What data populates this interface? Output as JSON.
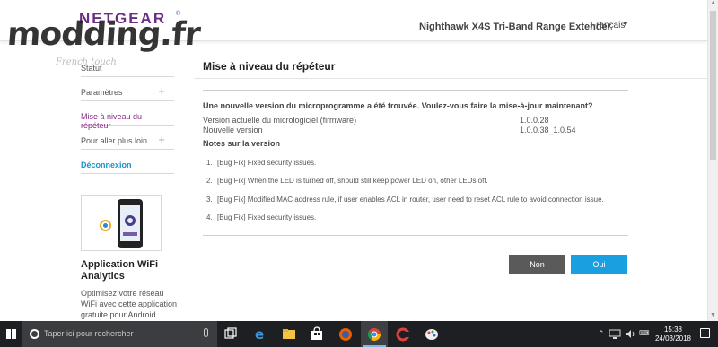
{
  "header": {
    "brand": "NETGEAR",
    "brand_mark": "®",
    "product": "Nighthawk X4S Tri-Band Range Extender",
    "language": "Français"
  },
  "watermark": {
    "text": "modding.fr",
    "sub": "French touch"
  },
  "sidebar": {
    "items": [
      {
        "label": "Statut",
        "expandable": false
      },
      {
        "label": "Paramètres",
        "expandable": true
      },
      {
        "label": "Mise à niveau du répéteur",
        "expandable": false,
        "active": true
      },
      {
        "label": "Pour aller plus loin",
        "expandable": true
      },
      {
        "label": "Déconnexion",
        "expandable": false
      }
    ],
    "app_title": "Application WiFi Analytics",
    "app_description": "Optimisez votre réseau WiFi avec cette application gratuite pour Android."
  },
  "main": {
    "title": "Mise à niveau du répéteur",
    "question": "Une nouvelle version du microprogramme a été trouvée. Voulez-vous faire la mise-à-jour maintenant?",
    "current_version_label": "Version actuelle du micrologiciel (firmware)",
    "current_version": "1.0.0.28",
    "new_version_label": "Nouvelle version",
    "new_version": "1.0.0.38_1.0.54",
    "notes_title": "Notes sur la version",
    "notes": [
      {
        "num": "1.",
        "text": "[Bug Fix] Fixed security issues."
      },
      {
        "num": "2.",
        "text": "[Bug Fix] When the LED is turned off, should still keep power LED on, other LEDs off."
      },
      {
        "num": "3.",
        "text": "[Bug Fix] Modified MAC address rule, if user enables ACL in router, user need to reset ACL rule to avoid connection issue."
      },
      {
        "num": "4.",
        "text": "[Bug Fix] Fixed security issues."
      }
    ],
    "button_no": "Non",
    "button_yes": "Oui"
  },
  "taskbar": {
    "search_placeholder": "Taper ici pour rechercher",
    "time": "15:38",
    "date": "24/03/2018",
    "apps": [
      "task-view",
      "edge",
      "file-explorer",
      "store",
      "firefox",
      "chrome",
      "ccleaner",
      "paint"
    ]
  },
  "colors": {
    "brand": "#6b2d83",
    "active_nav": "#8a2a86",
    "logout": "#1a92c9",
    "button_no": "#5a5a5a",
    "button_yes": "#1aa0e0",
    "taskbar": "#1e1f22"
  }
}
